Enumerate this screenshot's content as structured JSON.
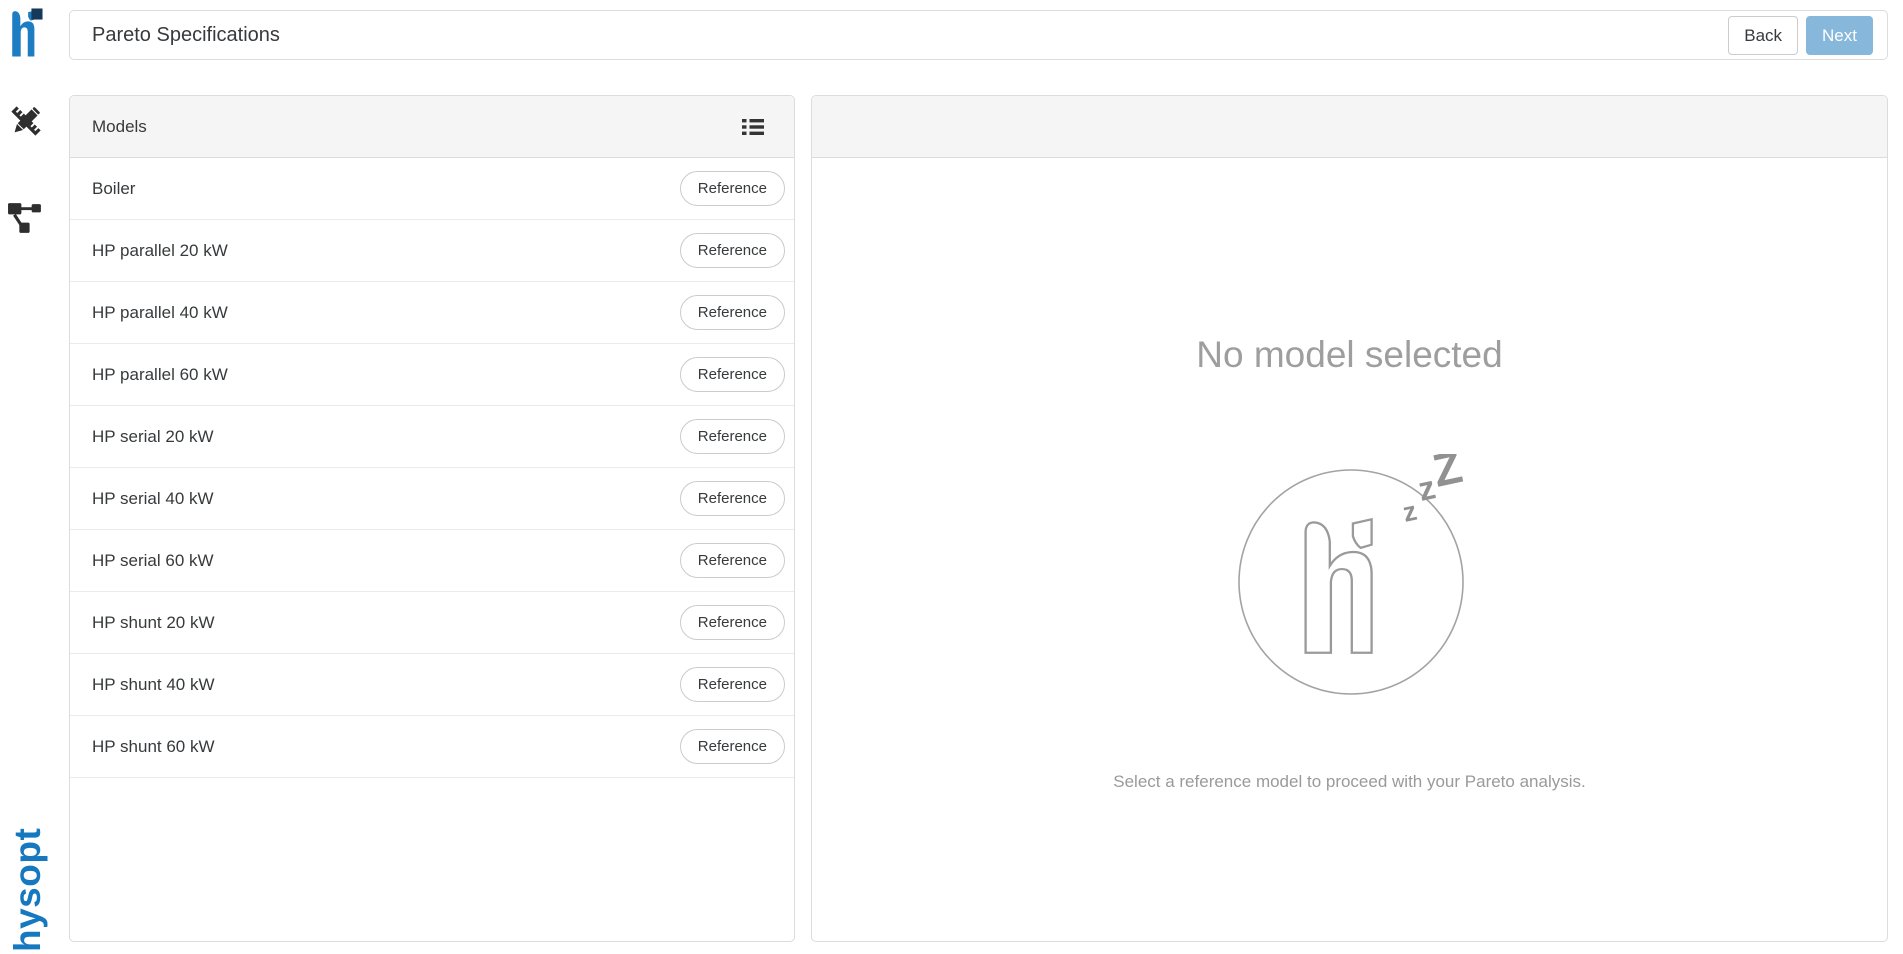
{
  "brand": {
    "wordmark": "hysopt",
    "logo_blue": "#1d7dc2",
    "logo_navy": "#15395b"
  },
  "header": {
    "title": "Pareto Specifications",
    "back_button": "Back",
    "next_button": "Next"
  },
  "models": {
    "title": "Models",
    "rows": [
      {
        "name": "Boiler",
        "action": "Reference"
      },
      {
        "name": "HP parallel 20 kW",
        "action": "Reference"
      },
      {
        "name": "HP parallel 40 kW",
        "action": "Reference"
      },
      {
        "name": "HP parallel 60 kW",
        "action": "Reference"
      },
      {
        "name": "HP serial 20 kW",
        "action": "Reference"
      },
      {
        "name": "HP serial 40 kW",
        "action": "Reference"
      },
      {
        "name": "HP serial 60 kW",
        "action": "Reference"
      },
      {
        "name": "HP shunt 20 kW",
        "action": "Reference"
      },
      {
        "name": "HP shunt 40 kW",
        "action": "Reference"
      },
      {
        "name": "HP shunt 60 kW",
        "action": "Reference"
      }
    ]
  },
  "empty": {
    "title": "No model selected",
    "hint": "Select a reference model to proceed with your Pareto analysis.",
    "sleep_z": [
      "z",
      "z",
      "Z"
    ]
  },
  "colors": {
    "accent_blue": "#1679c0",
    "next_button_bg": "#87b7da",
    "muted_text": "#9e9e9e",
    "panel_header_bg": "#f5f5f5",
    "border": "#dcdcdc"
  }
}
